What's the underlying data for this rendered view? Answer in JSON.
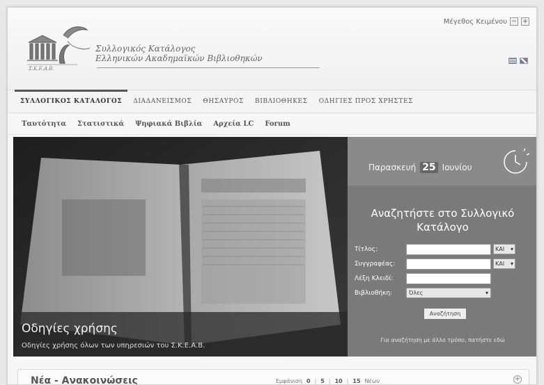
{
  "header": {
    "title_line1": "Συλλογικός Κατάλογος",
    "title_line2": "Ελληνικών Ακαδημαϊκών Βιβλιοθηκών",
    "logo_text": "Σ.Κ.Ε.Α.Β.",
    "text_size_label": "Μέγεθος Κειμένου",
    "text_size_minus": "−",
    "text_size_plus": "+"
  },
  "main_nav": {
    "items": [
      {
        "label": "ΣΥΛΛΟΓΙΚΟΣ ΚΑΤΑΛΟΓΟΣ"
      },
      {
        "label": "ΔΙΑΔΑΝΕΙΣΜΟΣ"
      },
      {
        "label": "ΘΗΣΑΥΡΟΣ"
      },
      {
        "label": "ΒΙΒΛΙΟΘΗΚΕΣ"
      },
      {
        "label": "ΟΔΗΓΙΕΣ ΠΡΟΣ ΧΡΗΣΤΕΣ"
      }
    ]
  },
  "sub_nav": {
    "items": [
      {
        "label": "Ταυτότητα"
      },
      {
        "label": "Στατιστικά"
      },
      {
        "label": "Ψηφιακά Βιβλία"
      },
      {
        "label": "Αρχεία LC"
      },
      {
        "label": "Forum"
      }
    ]
  },
  "hero": {
    "title": "Οδηγίες χρήσης",
    "subtitle": "Οδηγίες χρήσης όλων των υπηρεσιών του Σ.Κ.Ε.Α.Β."
  },
  "search": {
    "day_name": "Παρασκευή",
    "day_num": "25",
    "month": "Ιουνίου",
    "title": "Αναζητήστε στο Συλλογικό Κατάλογο",
    "fields": {
      "title_label": "Τίτλος:",
      "author_label": "Συγγραφέας:",
      "keyword_label": "Λέξη Κλειδί:",
      "library_label": "Βιβλιοθήκη:",
      "op1": "ΚΑΙ",
      "op2": "ΚΑΙ",
      "library_value": "Όλες"
    },
    "button": "Αναζήτηση",
    "alt_link": "Για αναζήτηση με άλλο τρόπο, πατήστε εδώ"
  },
  "news": {
    "title": "Νέα - Ανακοινώσεις",
    "paging_label": "Εμφάνιση",
    "pages": [
      "0",
      "5",
      "10",
      "15"
    ],
    "all_label": "Νέων",
    "expand": "+"
  }
}
